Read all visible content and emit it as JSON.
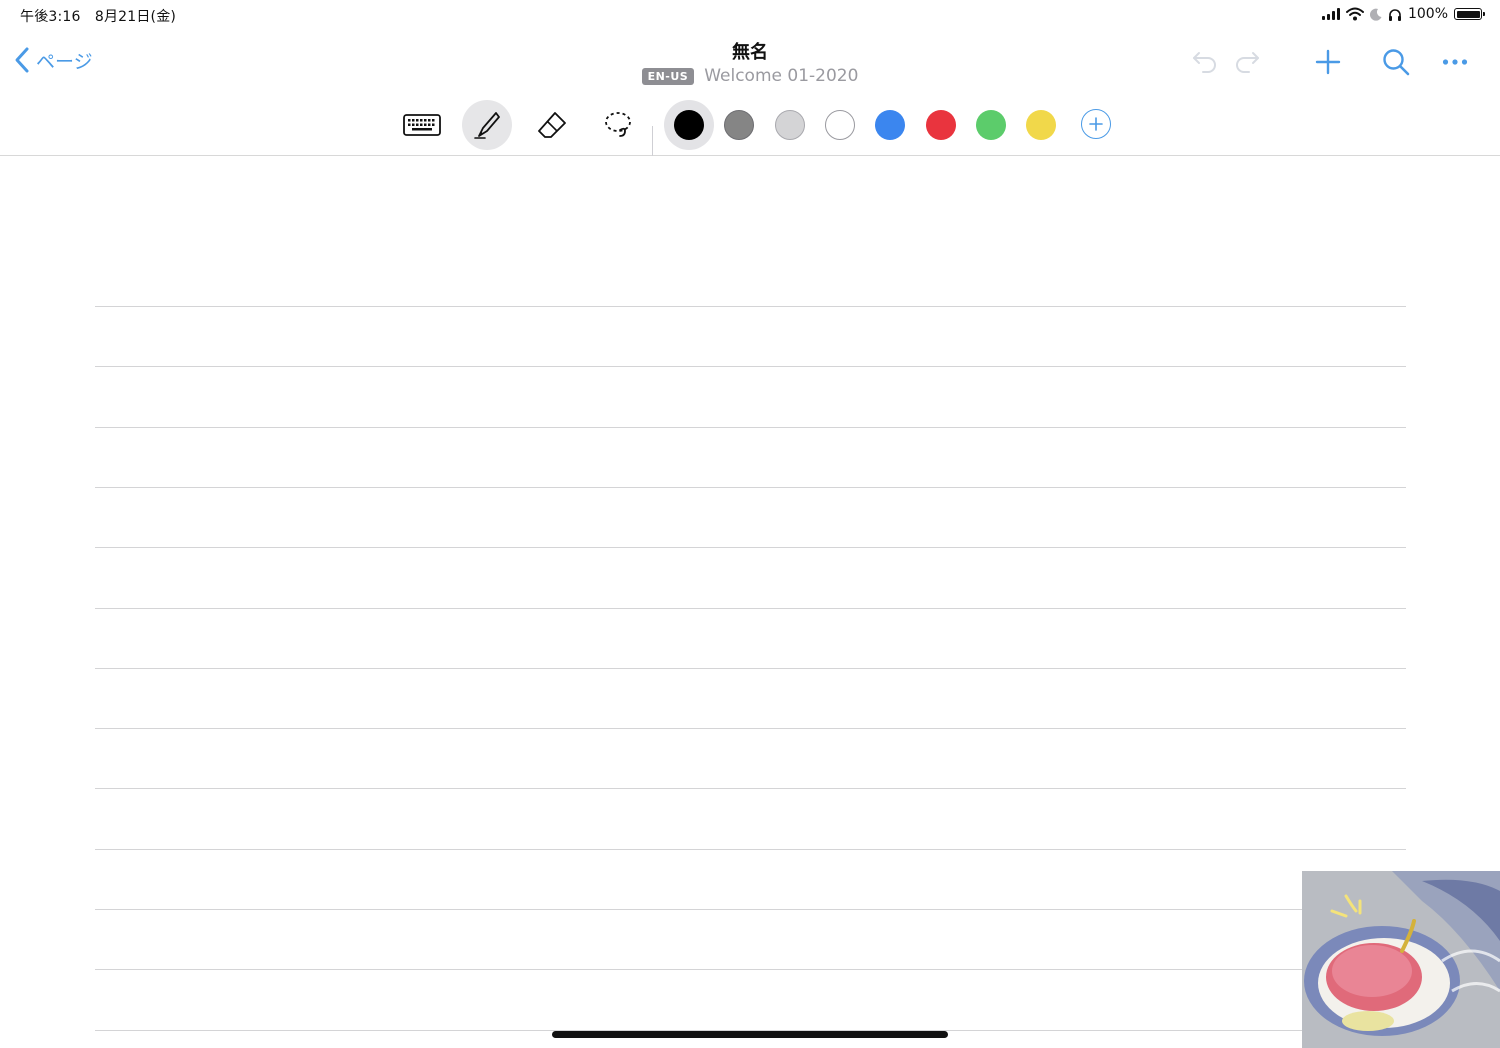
{
  "status_bar": {
    "time_date": "午後3:16　8月21日(金)",
    "battery_text": "100%",
    "battery_level": 1.0
  },
  "nav": {
    "back_label": "ページ",
    "title": "無名",
    "language_badge": "EN-US",
    "document_name": "Welcome 01-2020",
    "icons": [
      "undo-icon",
      "redo-icon",
      "plus-icon",
      "search-icon",
      "ellipsis-icon"
    ]
  },
  "toolbar": {
    "tools": [
      {
        "name": "keyboard",
        "icon": "keyboard-icon",
        "selected": false
      },
      {
        "name": "pen",
        "icon": "pen-icon",
        "selected": true
      },
      {
        "name": "eraser",
        "icon": "eraser-icon",
        "selected": false
      },
      {
        "name": "lasso",
        "icon": "lasso-icon",
        "selected": false
      }
    ],
    "colors": [
      {
        "name": "black",
        "hex": "#000000",
        "selected": true
      },
      {
        "name": "gray",
        "hex": "#858585",
        "selected": false
      },
      {
        "name": "light-gray",
        "hex": "#d4d4d6",
        "selected": false
      },
      {
        "name": "white",
        "hex": "#ffffff",
        "selected": false
      },
      {
        "name": "blue",
        "hex": "#3b86ef",
        "selected": false
      },
      {
        "name": "red",
        "hex": "#e9343e",
        "selected": false
      },
      {
        "name": "green",
        "hex": "#5ccc6b",
        "selected": false
      },
      {
        "name": "yellow",
        "hex": "#f1d84a",
        "selected": false
      }
    ],
    "accent": "#4a9ae6"
  }
}
